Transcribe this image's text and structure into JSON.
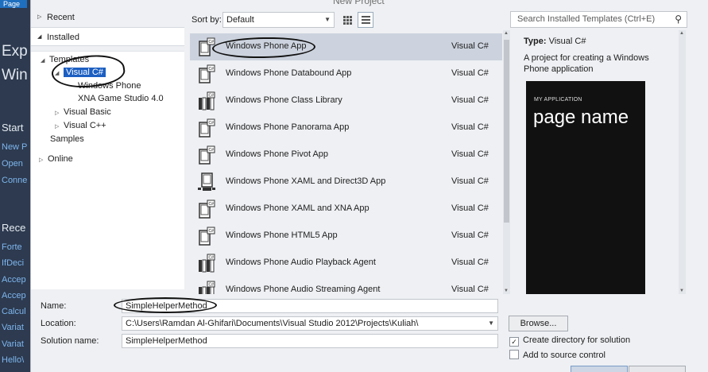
{
  "background_ide": {
    "tab_label": "Page",
    "big_lines": [
      "Exp",
      "Win"
    ],
    "start_heading": "Start",
    "start_links": [
      "New P",
      "Open",
      "Conne"
    ],
    "recent_heading": "Rece",
    "recent_links": [
      "Forte",
      "IfDeci",
      "Accep",
      "Accep",
      "Calcul",
      "Variat",
      "Variat",
      "Hello\\"
    ]
  },
  "dialog": {
    "title": "New Project"
  },
  "left_pane": {
    "recent_label": "Recent",
    "installed_label": "Installed",
    "tree": {
      "templates": "Templates",
      "visual_csharp": "Visual C#",
      "windows_phone": "Windows Phone",
      "xna": "XNA Game Studio 4.0",
      "visual_basic": "Visual Basic",
      "visual_cpp": "Visual C++",
      "samples": "Samples"
    },
    "online_label": "Online"
  },
  "toolbar": {
    "sort_by_label": "Sort by:",
    "sort_value": "Default",
    "search_placeholder": "Search Installed Templates (Ctrl+E)"
  },
  "templates": [
    {
      "name": "Windows Phone App",
      "lang": "Visual C#",
      "icon": "phone-icon"
    },
    {
      "name": "Windows Phone Databound App",
      "lang": "Visual C#",
      "icon": "phone-icon"
    },
    {
      "name": "Windows Phone Class Library",
      "lang": "Visual C#",
      "icon": "library-icon"
    },
    {
      "name": "Windows Phone Panorama App",
      "lang": "Visual C#",
      "icon": "phone-icon"
    },
    {
      "name": "Windows Phone Pivot App",
      "lang": "Visual C#",
      "icon": "phone-icon"
    },
    {
      "name": "Windows Phone XAML and Direct3D App",
      "lang": "Visual C#",
      "icon": "phone-d3d-icon"
    },
    {
      "name": "Windows Phone XAML and XNA App",
      "lang": "Visual C#",
      "icon": "phone-icon"
    },
    {
      "name": "Windows Phone HTML5 App",
      "lang": "Visual C#",
      "icon": "phone-icon"
    },
    {
      "name": "Windows Phone Audio Playback Agent",
      "lang": "Visual C#",
      "icon": "library-icon"
    },
    {
      "name": "Windows Phone Audio Streaming Agent",
      "lang": "Visual C#",
      "icon": "library-icon"
    }
  ],
  "info": {
    "type_label": "Type:",
    "type_value": "Visual C#",
    "description": "A project for creating a Windows Phone application",
    "preview_app_title": "MY APPLICATION",
    "preview_page_name": "page name"
  },
  "form": {
    "name_label": "Name:",
    "name_value": "SimpleHelperMethod",
    "location_label": "Location:",
    "location_value": "C:\\Users\\Ramdan Al-Ghifari\\Documents\\Visual Studio 2012\\Projects\\Kuliah\\",
    "solution_label": "Solution name:",
    "solution_value": "SimpleHelperMethod",
    "browse_label": "Browse...",
    "create_dir_label": "Create directory for solution",
    "create_dir_checked": true,
    "add_source_label": "Add to source control",
    "add_source_checked": false
  }
}
